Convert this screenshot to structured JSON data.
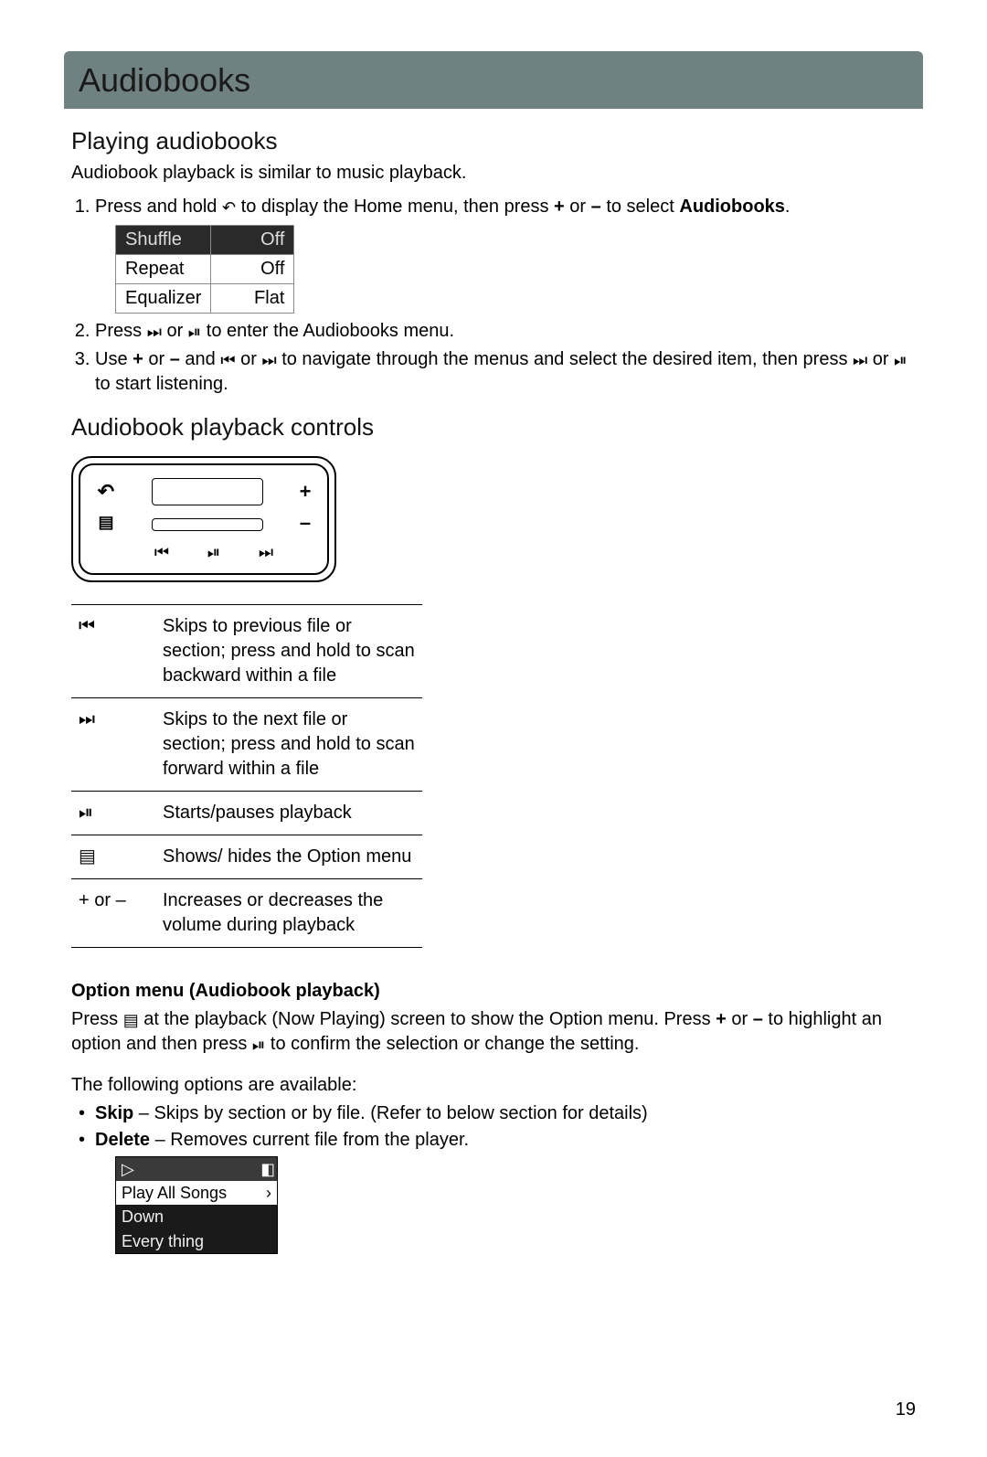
{
  "header": {
    "title": "Audiobooks"
  },
  "section_playing": {
    "heading": "Playing audiobooks",
    "intro": "Audiobook playback is similar to music playback.",
    "step1_a": "Press and hold ",
    "step1_b": " to display the Home menu, then press ",
    "step1_c": " to select ",
    "step1_target": "Audiobooks",
    "plus": "+",
    "or": " or ",
    "minus": "–",
    "menu": {
      "r1": {
        "label": "Shuffle",
        "value": "Off"
      },
      "r2": {
        "label": "Repeat",
        "value": "Off"
      },
      "r3": {
        "label": "Equalizer",
        "value": "Flat"
      }
    },
    "step2_a": "Press ",
    "step2_b": " to enter the Audiobooks menu.",
    "step3_a": "Use ",
    "step3_b": " and ",
    "step3_c": " to navigate through the menus and select the desired item, then press ",
    "step3_d": " to start listening."
  },
  "section_controls": {
    "heading": "Audiobook playback controls"
  },
  "icons": {
    "back": "↶",
    "ff": "⏭",
    "rew": "⏮",
    "playpause": "⏯",
    "optmenu": "▤",
    "plus": "+",
    "minus": "–",
    "play_outline": "▷",
    "battery": "▮▯",
    "chev": "›"
  },
  "controls_table": {
    "r1": {
      "sym": "⏮",
      "desc": "Skips to previous file or section; press and hold to scan backward within a file"
    },
    "r2": {
      "sym": "⏭",
      "desc": "Skips to the next file or section; press and hold to scan forward within a file"
    },
    "r3": {
      "sym": "⏯",
      "desc": "Starts/pauses playback"
    },
    "r4": {
      "sym": "▤",
      "desc": "Shows/ hides the Option menu"
    },
    "r5": {
      "sym": "+ or –",
      "desc": "Increases or decreases the volume during playback"
    }
  },
  "option_menu": {
    "heading": "Option menu (Audiobook playback)",
    "p1a": "Press ",
    "p1b": " at the playback (Now Playing) screen to show the Option menu. Press ",
    "p1c": " to highlight an option and then press ",
    "p1d": " to confirm the selection or change the setting.",
    "p2": "The following options are available:",
    "skip_label": "Skip",
    "skip_desc": " – Skips by section or by file. (Refer to below section for details)",
    "delete_label": "Delete",
    "delete_desc": " – Removes current file from the player."
  },
  "filelist": {
    "row1": "Play All Songs",
    "row2": "Down",
    "row3": "Every thing"
  },
  "page_number": "19"
}
